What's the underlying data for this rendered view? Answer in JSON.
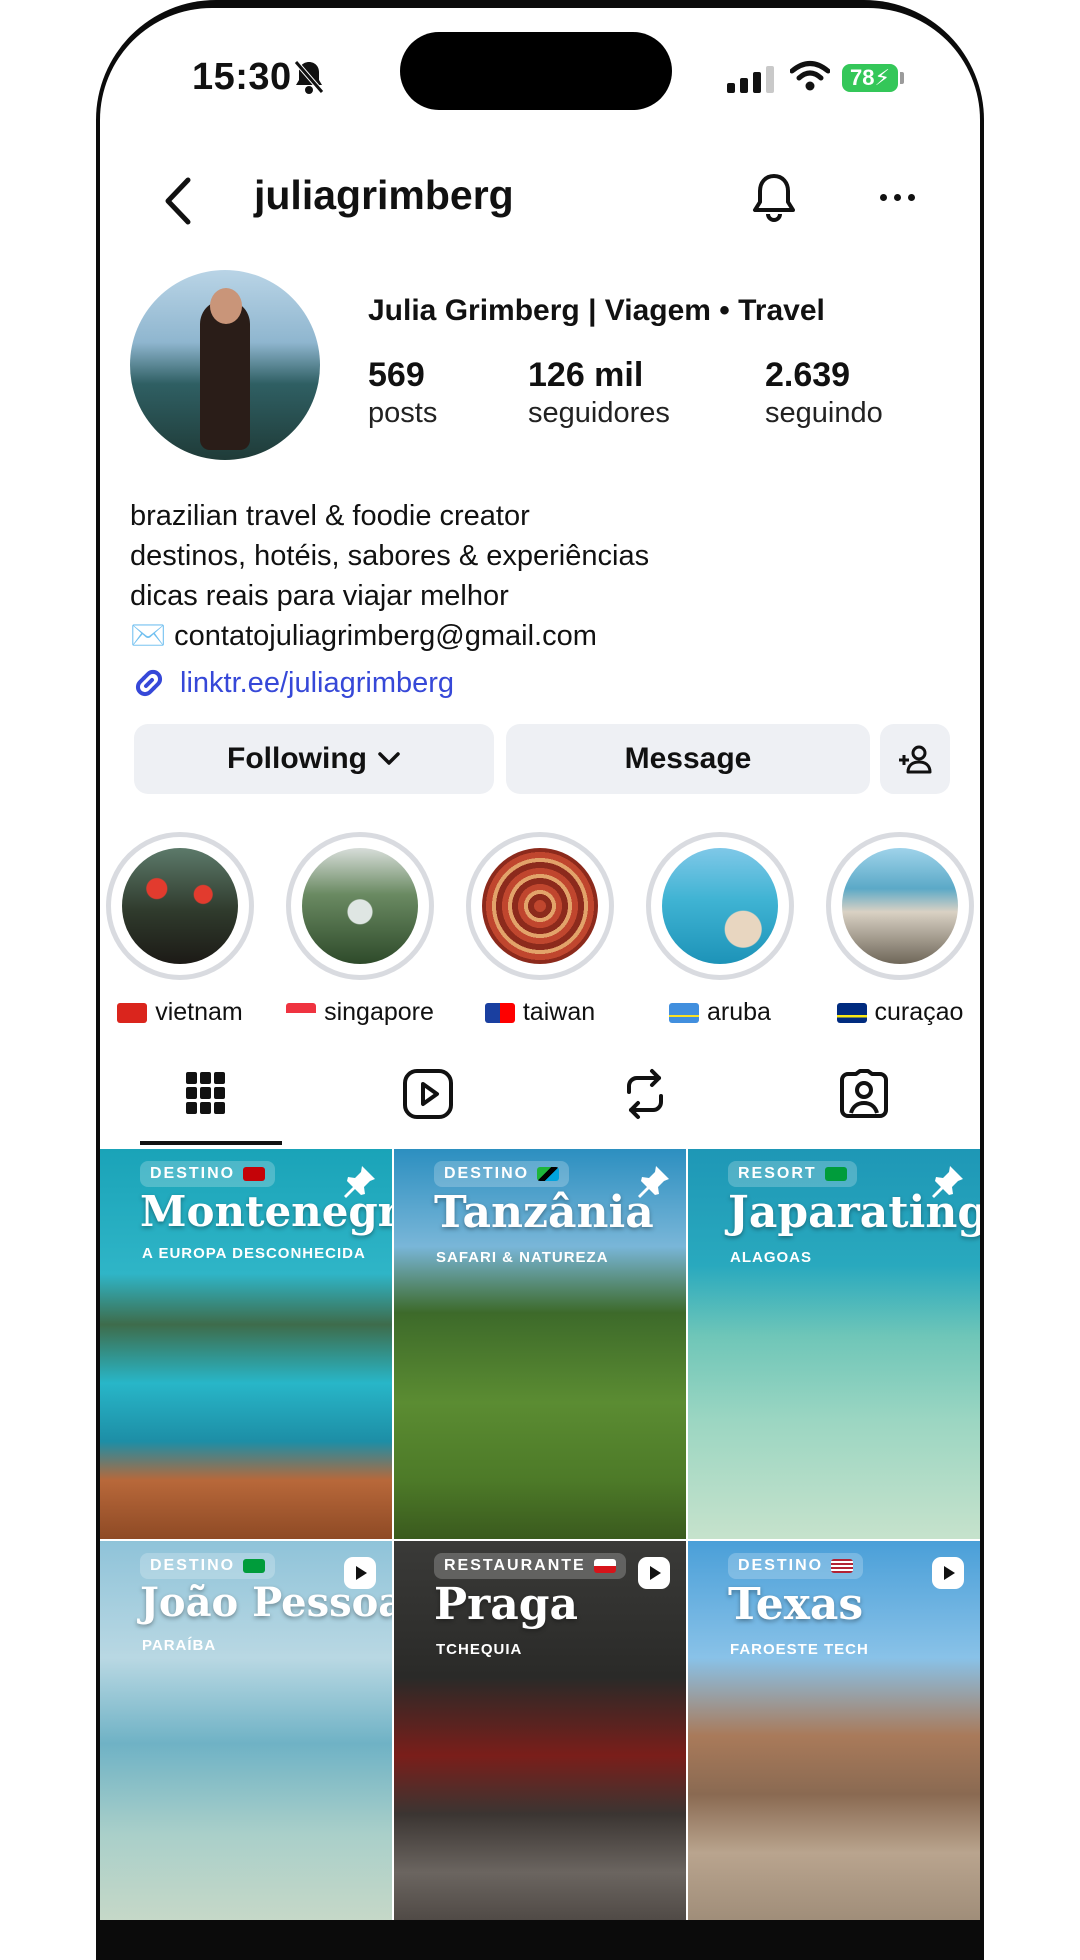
{
  "status_bar": {
    "time": "15:30",
    "battery": "78"
  },
  "header": {
    "username": "juliagrimberg"
  },
  "profile": {
    "display_name": "Julia Grimberg | Viagem • Travel",
    "stats": [
      {
        "value": "569",
        "label": "posts"
      },
      {
        "value": "126 mil",
        "label": "seguidores"
      },
      {
        "value": "2.639",
        "label": "seguindo"
      }
    ],
    "bio": [
      "brazilian travel & foodie creator",
      "destinos, hotéis, sabores & experiências",
      "dicas reais para viajar melhor",
      "✉️ contatojuliagrimberg@gmail.com"
    ],
    "link": "linktr.ee/juliagrimberg"
  },
  "actions": {
    "following": "Following",
    "message": "Message"
  },
  "highlights": [
    {
      "label": "vietnam"
    },
    {
      "label": "singapore"
    },
    {
      "label": "taiwan"
    },
    {
      "label": "aruba"
    },
    {
      "label": "curaçao"
    }
  ],
  "posts": [
    {
      "badge": "DESTINO",
      "title": "Montenegro",
      "subtitle": "A EUROPA DESCONHECIDA",
      "icon": "pin-icon"
    },
    {
      "badge": "DESTINO",
      "title": "Tanzânia",
      "subtitle": "SAFARI & NATUREZA",
      "icon": "pin-icon"
    },
    {
      "badge": "RESORT",
      "title": "Japaratinga",
      "subtitle": "ALAGOAS",
      "icon": "pin-icon"
    },
    {
      "badge": "DESTINO",
      "title": "João Pessoa",
      "subtitle": "PARAÍBA",
      "icon": "reel-icon"
    },
    {
      "badge": "RESTAURANTE",
      "title": "Praga",
      "subtitle": "TCHEQUIA",
      "icon": "reel-icon"
    },
    {
      "badge": "DESTINO",
      "title": "Texas",
      "subtitle": "FAROESTE TECH",
      "icon": "reel-icon"
    }
  ]
}
